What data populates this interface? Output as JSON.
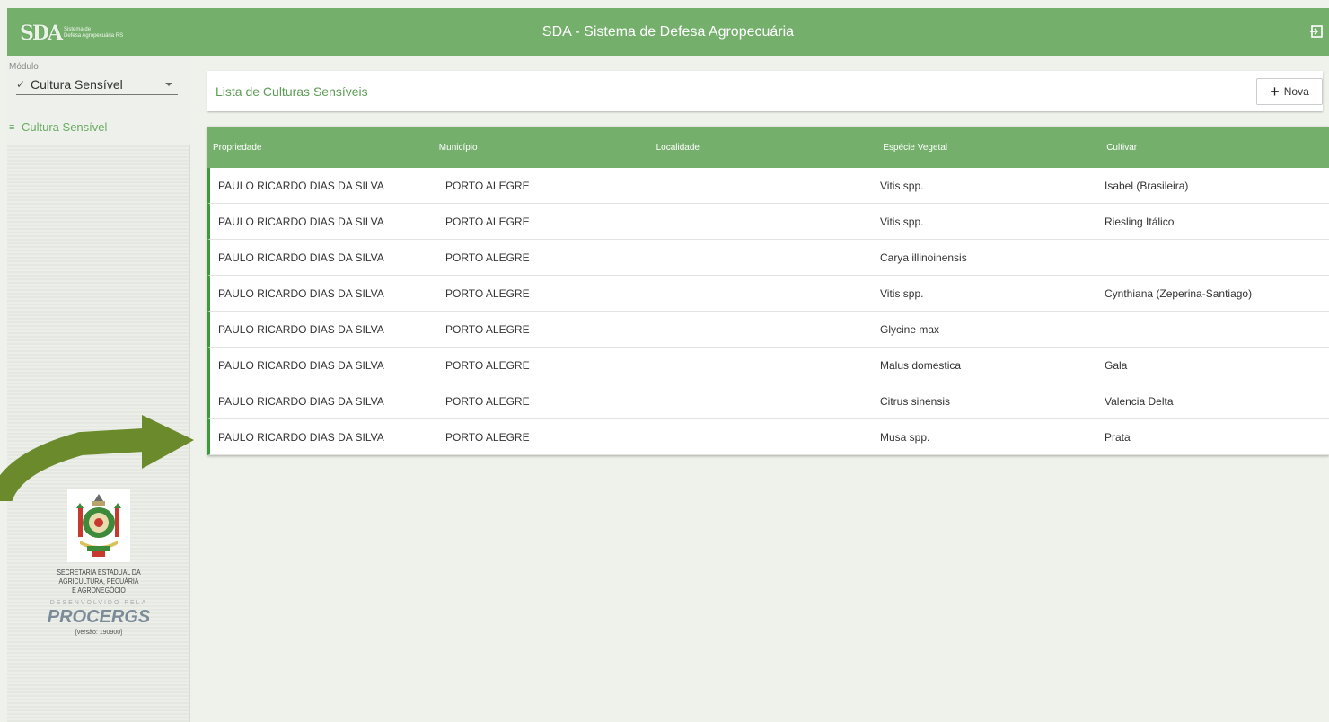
{
  "header": {
    "logo_mark": "SDA",
    "logo_line1": "Sistema de",
    "logo_line2": "Defesa Agropecuária RS",
    "title": "SDA - Sistema de Defesa Agropecuária",
    "exit_icon": "logout-icon"
  },
  "sidebar": {
    "module_label": "Módulo",
    "module_value": "Cultura Sensível",
    "nav_items": [
      {
        "label": "Cultura Sensível",
        "icon": "menu-icon"
      }
    ],
    "footer": {
      "secretaria_line1": "SECRETARIA ESTADUAL DA",
      "secretaria_line2": "AGRICULTURA, PECUÁRIA",
      "secretaria_line3": "E AGRONEGÓCIO",
      "desenvolvido": "DESENVOLVIDO PELA",
      "procergs": "PROCERGS",
      "versao": "[versão: 190900]"
    }
  },
  "main": {
    "list_title": "Lista de Culturas Sensíveis",
    "new_button": "Nova",
    "columns": [
      "Propriedade",
      "Município",
      "Localidade",
      "Espécie Vegetal",
      "Cultivar"
    ],
    "rows": [
      [
        "PAULO RICARDO DIAS DA SILVA",
        "PORTO ALEGRE",
        "",
        "Vitis spp.",
        "Isabel (Brasileira)"
      ],
      [
        "PAULO RICARDO DIAS DA SILVA",
        "PORTO ALEGRE",
        "",
        "Vitis spp.",
        "Riesling Itálico"
      ],
      [
        "PAULO RICARDO DIAS DA SILVA",
        "PORTO ALEGRE",
        "",
        "Carya illinoinensis",
        ""
      ],
      [
        "PAULO RICARDO DIAS DA SILVA",
        "PORTO ALEGRE",
        "",
        "Vitis spp.",
        "Cynthiana (Zeperina-Santiago)"
      ],
      [
        "PAULO RICARDO DIAS DA SILVA",
        "PORTO ALEGRE",
        "",
        "Glycine max",
        ""
      ],
      [
        "PAULO RICARDO DIAS DA SILVA",
        "PORTO ALEGRE",
        "",
        "Malus domestica",
        "Gala"
      ],
      [
        "PAULO RICARDO DIAS DA SILVA",
        "PORTO ALEGRE",
        "",
        "Citrus sinensis",
        "Valencia Delta"
      ],
      [
        "PAULO RICARDO DIAS DA SILVA",
        "PORTO ALEGRE",
        "",
        "Musa spp.",
        "Prata"
      ]
    ]
  },
  "colors": {
    "brand_green": "#74b06c",
    "row_accent": "#3b9a3a",
    "arrow": "#6b8a2c"
  }
}
